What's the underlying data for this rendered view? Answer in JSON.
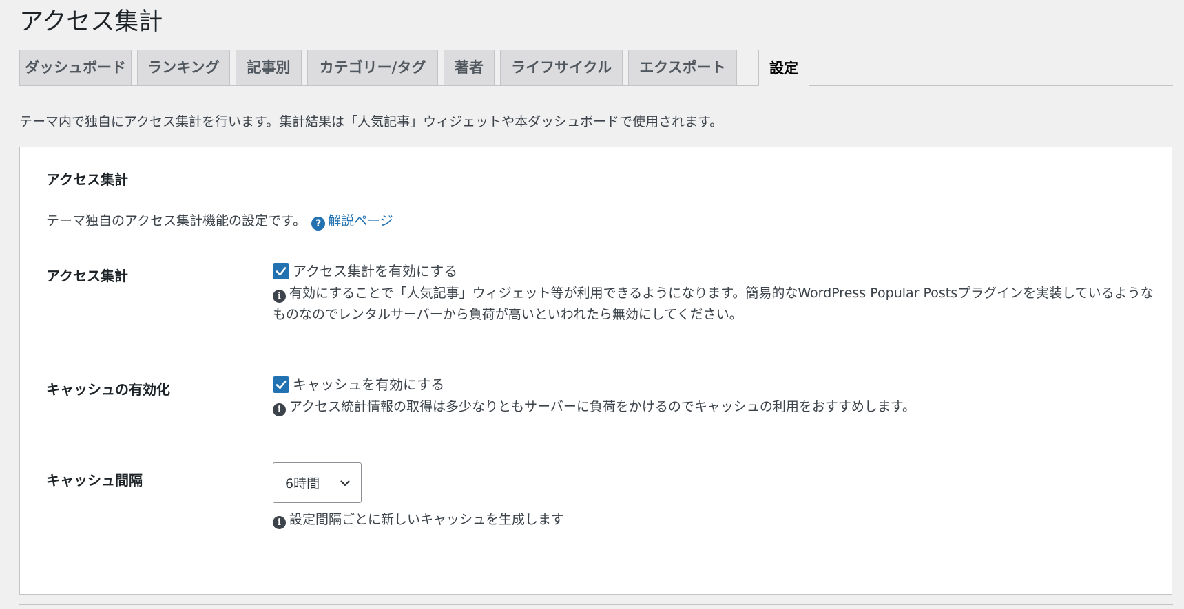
{
  "page": {
    "title": "アクセス集計"
  },
  "tabs": [
    {
      "label": "ダッシュボード",
      "active": false
    },
    {
      "label": "ランキング",
      "active": false
    },
    {
      "label": "記事別",
      "active": false
    },
    {
      "label": "カテゴリー/タグ",
      "active": false
    },
    {
      "label": "著者",
      "active": false
    },
    {
      "label": "ライフサイクル",
      "active": false
    },
    {
      "label": "エクスポート",
      "active": false
    },
    {
      "label": "設定",
      "active": true
    }
  ],
  "intro": "テーマ内で独自にアクセス集計を行います。集計結果は「人気記事」ウィジェットや本ダッシュボードで使用されます。",
  "section": {
    "title": "アクセス集計",
    "description": "テーマ独自のアクセス集計機能の設定です。",
    "help_icon": "?",
    "help_link": "解説ページ"
  },
  "settings": {
    "access": {
      "label": "アクセス集計",
      "checkbox_label": "アクセス集計を有効にする",
      "checked": true,
      "note": "有効にすることで「人気記事」ウィジェット等が利用できるようになります。簡易的なWordPress Popular Postsプラグインを実装しているようなものなのでレンタルサーバーから負荷が高いといわれたら無効にしてください。"
    },
    "cache": {
      "label": "キャッシュの有効化",
      "checkbox_label": "キャッシュを有効にする",
      "checked": true,
      "note": "アクセス統計情報の取得は多少なりともサーバーに負荷をかけるのでキャッシュの利用をおすすめします。"
    },
    "interval": {
      "label": "キャッシュ間隔",
      "selected": "6時間",
      "note": "設定間隔ごとに新しいキャッシュを生成します"
    }
  },
  "icons": {
    "info": "i",
    "help": "question-circle-icon",
    "check": "checkmark-icon",
    "dropdown": "chevron-down-icon"
  },
  "colors": {
    "background": "#f0f0f1",
    "accent": "#2271b1",
    "text": "#1d2327",
    "tab_inactive": "#dcdcde"
  }
}
